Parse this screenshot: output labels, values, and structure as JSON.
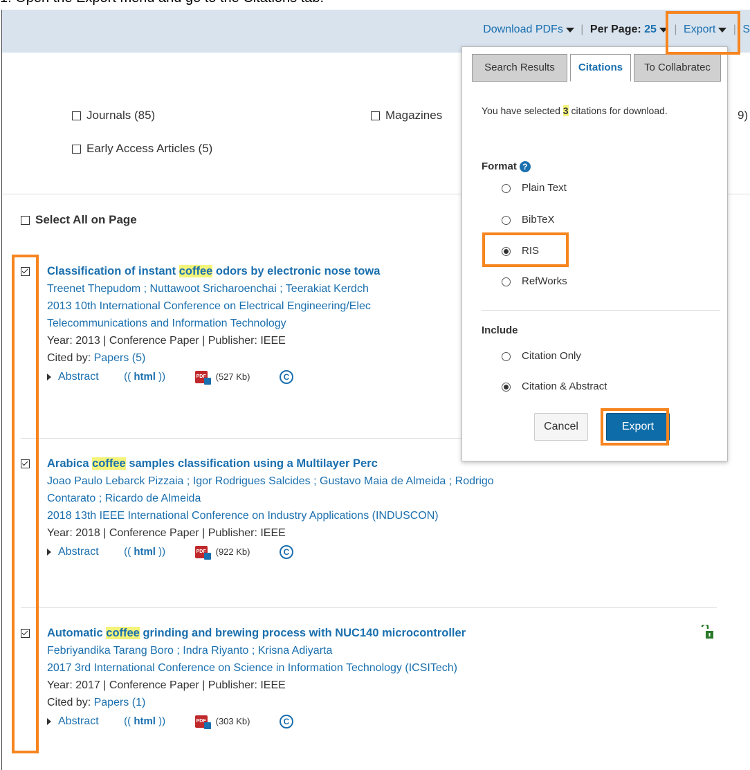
{
  "instruction": "1.  Open the Export menu and go to the Citations tab.",
  "topbar": {
    "download_pdfs": "Download PDFs",
    "per_page_label": "Per Page:",
    "per_page_value": "25",
    "export": "Export",
    "next_item": "S"
  },
  "filters": {
    "journals": "Journals (85)",
    "magazines": "Magazines",
    "cut_text": "9)",
    "early_access": "Early Access Articles (5)"
  },
  "select_all": "Select All on Page",
  "results": [
    {
      "title_pre": "Classification of instant ",
      "title_hl": "coffee",
      "title_post": " odors by electronic nose towa",
      "authors": "Treenet Thepudom ; Nuttawoot Sricharoenchai ; Teerakiat Kerdch",
      "venue1": "2013 10th International Conference on Electrical Engineering/Elec",
      "venue2": "Telecommunications and Information Technology",
      "meta": "Year: 2013 | Conference Paper | Publisher: IEEE",
      "cited_label": "Cited by: ",
      "cited_link": "Papers (5)",
      "abstract": "Abstract",
      "html": "html",
      "pdf_size": "(527 Kb)",
      "checked": true
    },
    {
      "title_pre": "Arabica ",
      "title_hl": "coffee",
      "title_post": " samples classification using a Multilayer Perc",
      "authors": "Joao Paulo Lebarck Pizzaia ; Igor Rodrigues Salcides ; Gustavo Maia de Almeida ; Rodrigo",
      "authors2": "Contarato ; Ricardo de Almeida",
      "venue1": "2018 13th IEEE International Conference on Industry Applications (INDUSCON)",
      "meta": "Year: 2018 | Conference Paper | Publisher: IEEE",
      "abstract": "Abstract",
      "html": "html",
      "pdf_size": "(922 Kb)",
      "checked": true
    },
    {
      "title_pre": "Automatic ",
      "title_hl": "coffee",
      "title_post": " grinding and brewing process with NUC140 microcontroller",
      "authors": "Febriyandika Tarang Boro ; Indra Riyanto ; Krisna Adiyarta",
      "venue1": "2017 3rd International Conference on Science in Information Technology (ICSITech)",
      "meta": "Year: 2017 | Conference Paper | Publisher: IEEE",
      "cited_label": "Cited by: ",
      "cited_link": "Papers (1)",
      "abstract": "Abstract",
      "html": "html",
      "pdf_size": "(303 Kb)",
      "checked": true
    }
  ],
  "export_panel": {
    "tabs": [
      "Search Results",
      "Citations",
      "To Collabratec"
    ],
    "active_tab": "Citations",
    "selected_pre": "You have selected ",
    "selected_count": "3",
    "selected_post": " citations for download.",
    "format_label": "Format",
    "formats": [
      "Plain Text",
      "BibTeX",
      "RIS",
      "RefWorks"
    ],
    "selected_format": "RIS",
    "include_label": "Include",
    "include_options": [
      "Citation Only",
      "Citation & Abstract"
    ],
    "selected_include": "Citation & Abstract",
    "cancel": "Cancel",
    "export": "Export"
  },
  "colors": {
    "accent": "#1a6fae",
    "annotation": "#f7851f",
    "highlight": "#f4f47a",
    "topbar_bg": "#d8e3ee"
  }
}
